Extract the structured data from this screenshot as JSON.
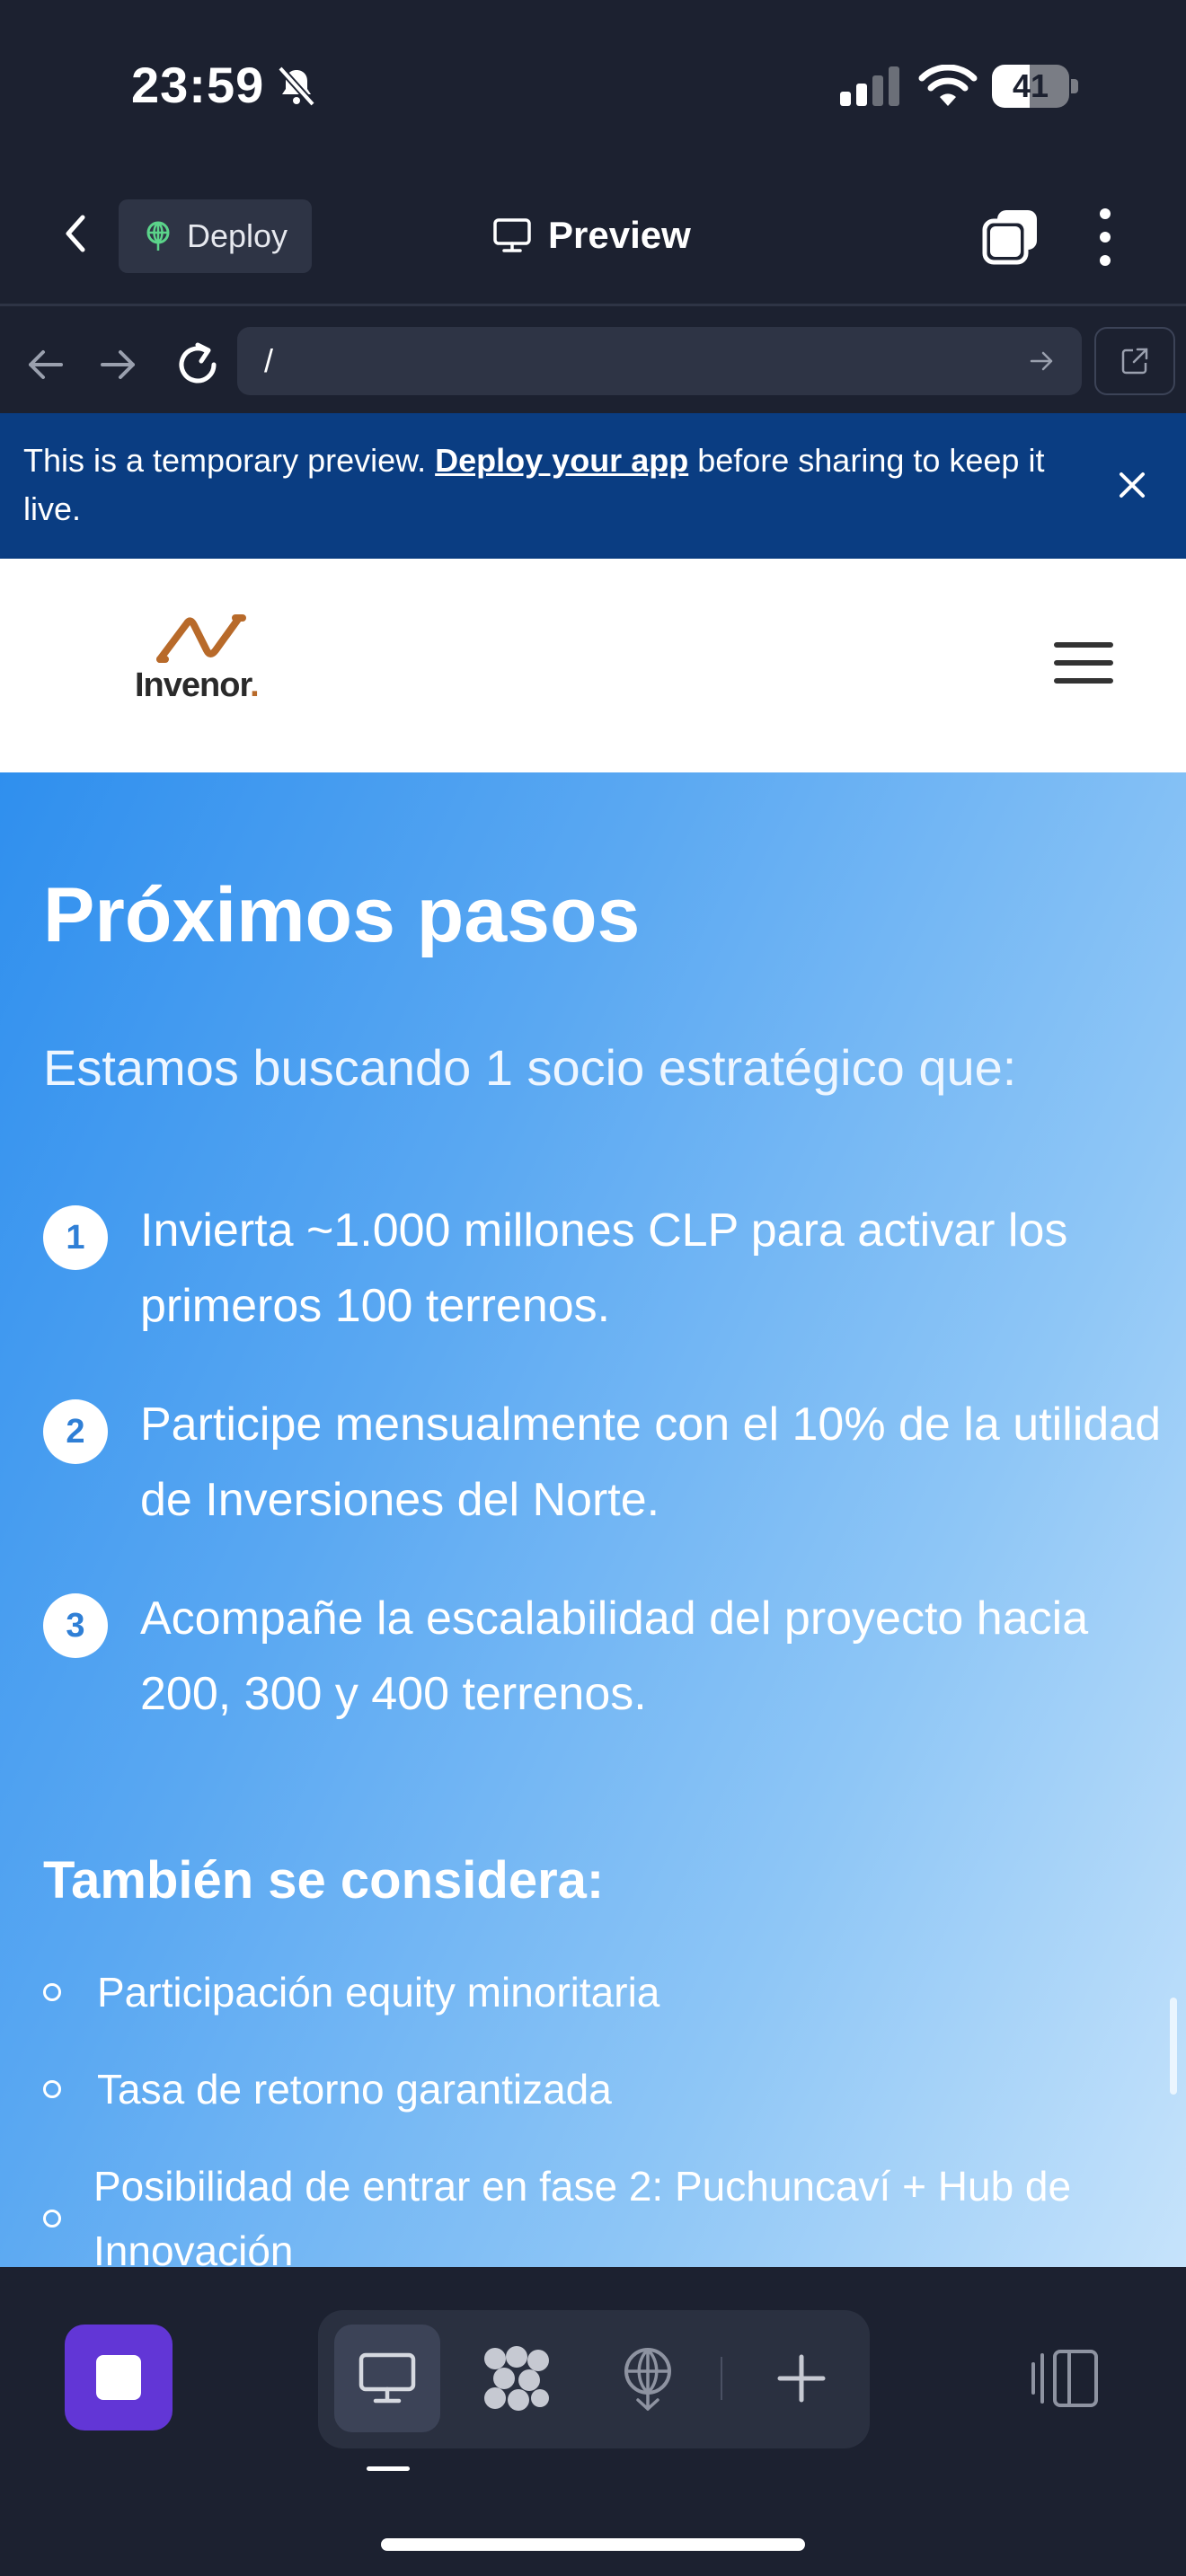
{
  "status_bar": {
    "time": "23:59",
    "battery": "41"
  },
  "topbar": {
    "deploy_label": "Deploy",
    "title": "Preview"
  },
  "url_bar": {
    "value": "/"
  },
  "banner": {
    "text_before": "This is a temporary preview. ",
    "link": "Deploy your app",
    "text_after": " before sharing to keep it live."
  },
  "site": {
    "logo_text": "Invenor",
    "logo_dot": ".",
    "brand_color": "#b86a2a"
  },
  "hero": {
    "title": "Próximos pasos",
    "subtitle": "Estamos buscando 1 socio estratégico que:",
    "steps": [
      {
        "num": "1",
        "text": "Invierta ~1.000 millones CLP para activar los primeros 100 terrenos."
      },
      {
        "num": "2",
        "text": "Participe mensualmente con el 10% de la utilidad de Inversiones del Norte."
      },
      {
        "num": "3",
        "text": "Acompañe la escalabilidad del proyecto hacia 200, 300 y 400 terrenos."
      }
    ],
    "also_title": "También se considera:",
    "also_items": [
      "Participación equity minoritaria",
      "Tasa de retorno garantizada",
      "Posibilidad de entrar en fase 2: Puchuncaví + Hub de Innovación"
    ]
  },
  "colors": {
    "app_bg": "#1c2130",
    "banner": "#0a3d82",
    "stop_button": "#6236d6",
    "hero_start": "#2f8fee",
    "hero_end": "#c6e3fb"
  },
  "icons": [
    "bell-slash-icon",
    "signal-icon",
    "wifi-icon",
    "battery-icon",
    "chevron-left-icon",
    "deploy-icon",
    "monitor-icon",
    "tabs-icon",
    "more-vertical-icon",
    "arrow-left-icon",
    "arrow-right-icon",
    "reload-icon",
    "open-external-icon",
    "close-icon",
    "hamburger-icon",
    "desktop-icon",
    "agent-icon",
    "deploy-tool-icon",
    "plus-icon",
    "panel-icon"
  ]
}
